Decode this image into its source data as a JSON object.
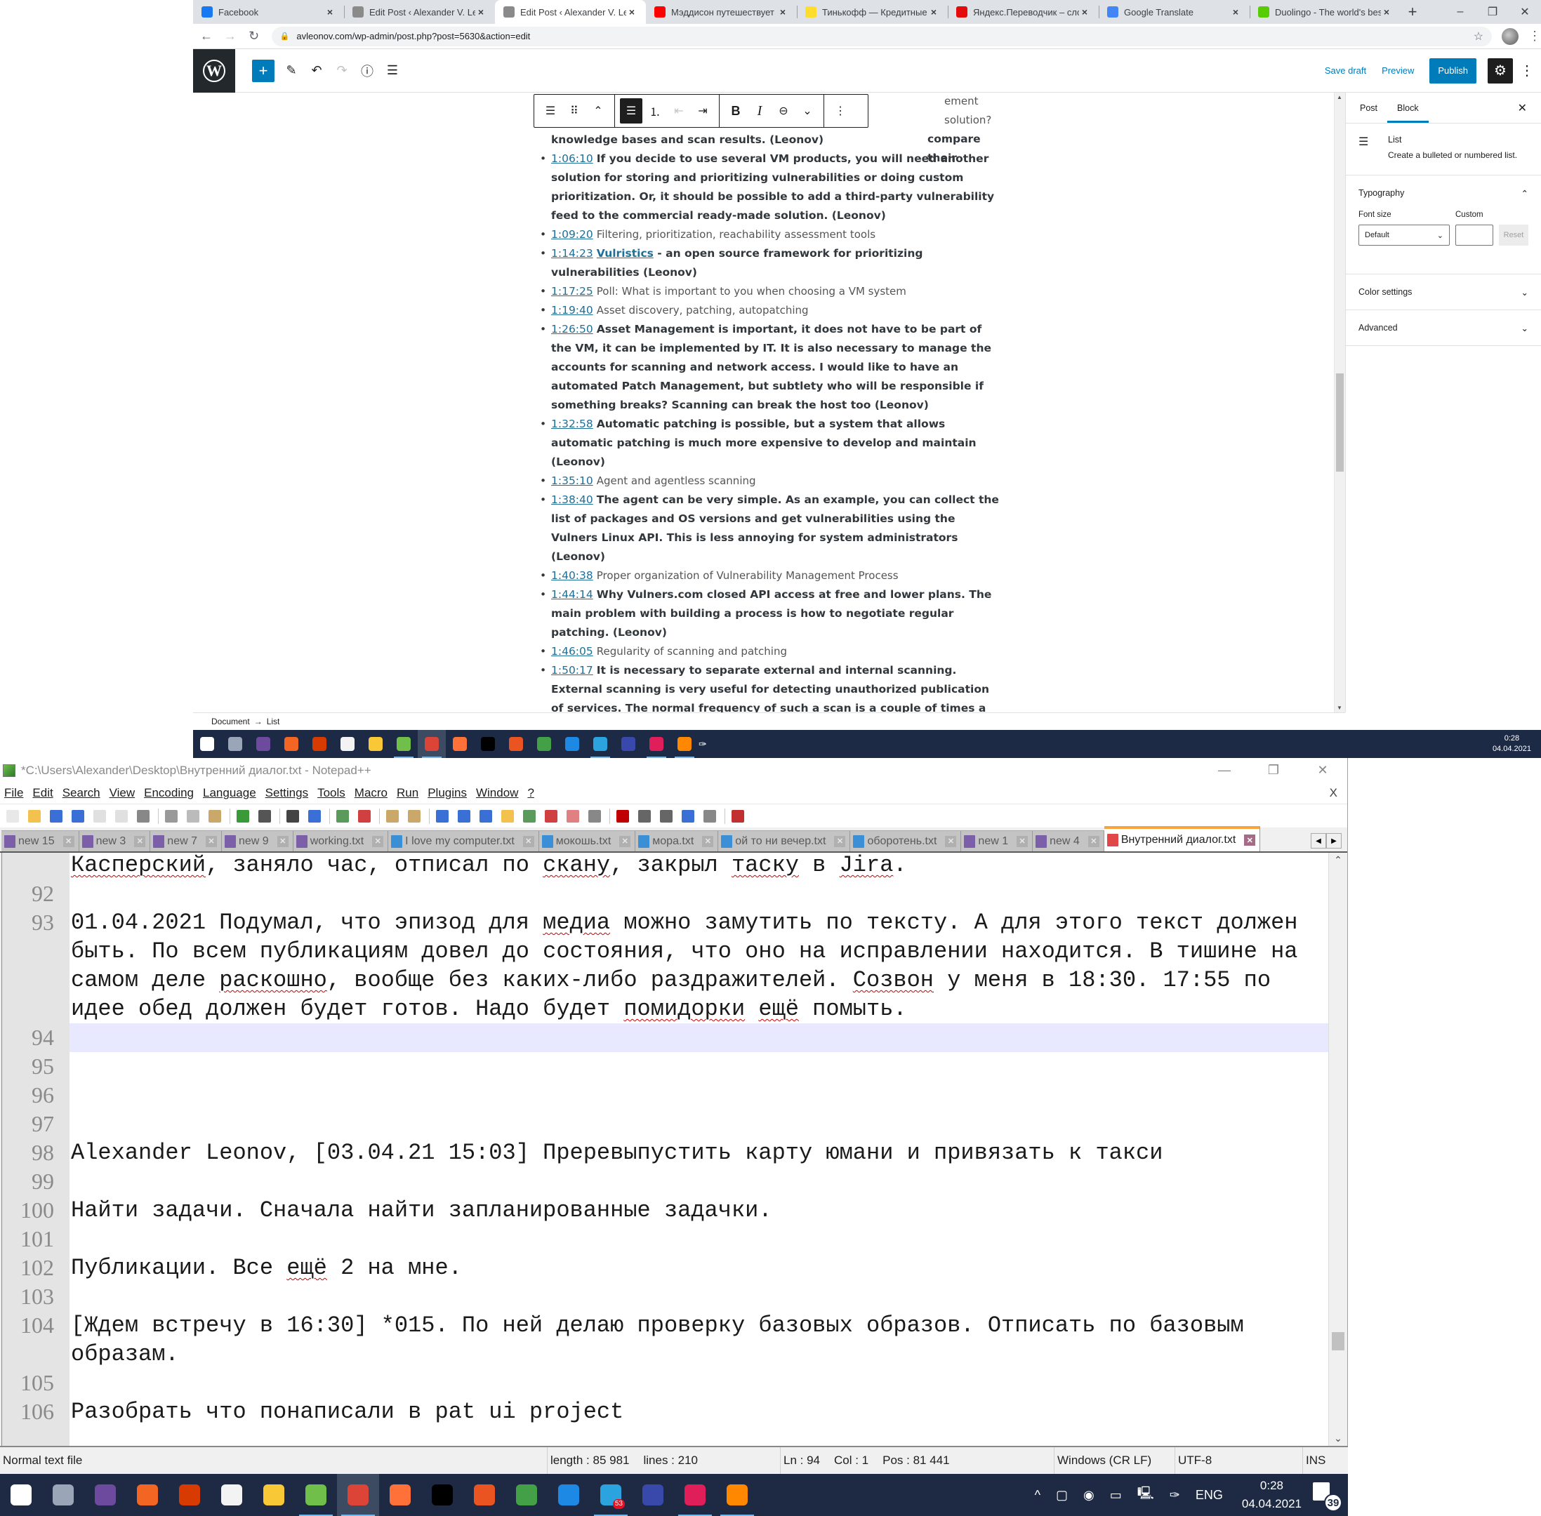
{
  "browser": {
    "tabs": [
      {
        "title": "Facebook",
        "favicon": "facebook-icon",
        "color": "#1877f2",
        "active": false
      },
      {
        "title": "Edit Post ‹ Alexander V. Leo",
        "favicon": "avl-icon",
        "color": "#8a8a8a",
        "active": false
      },
      {
        "title": "Edit Post ‹ Alexander V. Leo",
        "favicon": "avl-icon",
        "color": "#8a8a8a",
        "active": true
      },
      {
        "title": "Мэддисон путешествует по",
        "favicon": "youtube-icon",
        "color": "#ff0000",
        "active": false
      },
      {
        "title": "Тинькофф — Кредитные и",
        "favicon": "tinkoff-icon",
        "color": "#ffdd2d",
        "active": false
      },
      {
        "title": "Яндекс.Переводчик – слов",
        "favicon": "yandex-translate-icon",
        "color": "#e30b0b",
        "active": false
      },
      {
        "title": "Google Translate",
        "favicon": "google-translate-icon",
        "color": "#4285f4",
        "active": false
      },
      {
        "title": "Duolingo - The world's best",
        "favicon": "duolingo-icon",
        "color": "#58cc02",
        "active": false
      }
    ],
    "url": "avleonov.com/wp-admin/post.php?post=5630&action=edit"
  },
  "wp": {
    "header": {
      "save_draft": "Save draft",
      "preview": "Preview",
      "publish": "Publish",
      "accent": "#007cba"
    },
    "partial_first_line": "ement solution?",
    "partial_second_line": "compare their",
    "list_items": [
      {
        "ts": "",
        "bold": true,
        "text": "knowledge bases and scan results. (Leonov)",
        "continuation": true
      },
      {
        "ts": "1:06:10",
        "bold": true,
        "text": "If you decide to use several VM products, you will need another solution for storing and prioritizing vulnerabilities or doing custom prioritization. Or, it should be possible to add a third-party vulnerability feed to the commercial ready-made solution. (Leonov)"
      },
      {
        "ts": "1:09:20",
        "bold": false,
        "text": "Filtering, prioritization, reachability assessment tools"
      },
      {
        "ts": "1:14:23",
        "bold": true,
        "link": "Vulristics",
        "text": " - an open source framework for prioritizing vulnerabilities (Leonov)"
      },
      {
        "ts": "1:17:25",
        "bold": false,
        "text": "Poll: What is important to you when choosing a VM system"
      },
      {
        "ts": "1:19:40",
        "bold": false,
        "text": "Asset discovery, patching, autopatching"
      },
      {
        "ts": "1:26:50",
        "bold": true,
        "text": "Asset Management is important, it does not have to be part of the VM, it can be implemented by IT. It is also necessary to manage the accounts for scanning and network access. I would like to have an automated Patch Management, but subtlety who will be responsible if something breaks? Scanning can break the host too (Leonov)"
      },
      {
        "ts": "1:32:58",
        "bold": true,
        "text": "Automatic patching is possible, but a system that allows automatic patching is much more expensive to develop and maintain (Leonov)"
      },
      {
        "ts": "1:35:10",
        "bold": false,
        "text": "Agent and agentless scanning"
      },
      {
        "ts": "1:38:40",
        "bold": true,
        "text": "The agent can be very simple. As an example, you can collect the list of packages and OS versions and get vulnerabilities using the Vulners Linux API. This is less annoying for system administrators (Leonov)"
      },
      {
        "ts": "1:40:38",
        "bold": false,
        "text": "Proper organization of Vulnerability Management Process"
      },
      {
        "ts": "1:44:14",
        "bold": true,
        "text": "Why Vulners.com closed API access at free and lower plans. The main problem with building a process is how to negotiate regular patching. (Leonov)"
      },
      {
        "ts": "1:46:05",
        "bold": false,
        "text": "Regularity of scanning and patching"
      },
      {
        "ts": "1:50:17",
        "bold": true,
        "text": "It is necessary to separate external and internal scanning. External scanning is very useful for detecting unauthorized publication of services. The normal frequency of such a scan is a couple of times a week. Active internal scanning depends on agreements with the system owners. If you can say \"we scan everything - if you are not ready, your problems\" is good, but it does not work everywhere and not always. (Leonov)"
      }
    ],
    "sidebar": {
      "tabs": [
        "Post",
        "Block"
      ],
      "active_tab": "Block",
      "block_name": "List",
      "block_desc": "Create a bulleted or numbered list.",
      "typography": "Typography",
      "font_size_label": "Font size",
      "custom_label": "Custom",
      "font_size_value": "Default",
      "reset": "Reset",
      "color_settings": "Color settings",
      "advanced": "Advanced"
    },
    "breadcrumb": [
      "Document",
      "List"
    ]
  },
  "taskbar_top": {
    "time": "0:28",
    "date": "04.04.2021"
  },
  "npp": {
    "title": "*C:\\Users\\Alexander\\Desktop\\Внутренний диалог.txt - Notepad++",
    "menu": [
      "File",
      "Edit",
      "Search",
      "View",
      "Encoding",
      "Language",
      "Settings",
      "Tools",
      "Macro",
      "Run",
      "Plugins",
      "Window",
      "?"
    ],
    "close_doc": "X",
    "tabs": [
      {
        "label": "new 15",
        "color": "#7b5fa8"
      },
      {
        "label": "new 3",
        "color": "#7b5fa8"
      },
      {
        "label": "new 7",
        "color": "#7b5fa8"
      },
      {
        "label": "new 9",
        "color": "#7b5fa8"
      },
      {
        "label": "working.txt",
        "color": "#7b5fa8"
      },
      {
        "label": "I love my computer.txt",
        "color": "#3a8fd6"
      },
      {
        "label": "мокошь.txt",
        "color": "#3a8fd6"
      },
      {
        "label": "мора.txt",
        "color": "#3a8fd6"
      },
      {
        "label": "ой то ни вечер.txt",
        "color": "#3a8fd6"
      },
      {
        "label": "оборотень.txt",
        "color": "#3a8fd6"
      },
      {
        "label": "new 1",
        "color": "#7b5fa8"
      },
      {
        "label": "new 4",
        "color": "#7b5fa8"
      },
      {
        "label": "Внутренний диалог.txt",
        "color": "#e04848",
        "active": true
      }
    ],
    "lines": [
      {
        "n": "",
        "text": "Касперский, заняло час, отписал по скану, закрыл таску в Jira."
      },
      {
        "n": "92",
        "text": ""
      },
      {
        "n": "93",
        "text": "01.04.2021 Подумал, что эпизод для медиа можно замутить по тексту. А для этого текст должен быть. По всем публикациям довел до состояния, что оно на исправлении находится. В тишине на самом деле раскошно, вообще без каких-либо раздражителей. Созвон у меня в 18:30. 17:55 по идее обед должен будет готов. Надо будет помидорки ещё помыть."
      },
      {
        "n": "94",
        "text": "",
        "current": true
      },
      {
        "n": "95",
        "text": ""
      },
      {
        "n": "96",
        "text": ""
      },
      {
        "n": "97",
        "text": ""
      },
      {
        "n": "98",
        "text": "Alexander Leonov, [03.04.21 15:03] Преревыпустить карту юмани и привязать к такси"
      },
      {
        "n": "99",
        "text": ""
      },
      {
        "n": "100",
        "text": "Найти задачи. Сначала найти запланированные задачки."
      },
      {
        "n": "101",
        "text": ""
      },
      {
        "n": "102",
        "text": "Публикации. Все ещё 2 на мне."
      },
      {
        "n": "103",
        "text": ""
      },
      {
        "n": "104",
        "text": "[Ждем встречу в 16:30] *015. По ней делаю проверку базовых образов. Отписать по базовым образам."
      },
      {
        "n": "105",
        "text": ""
      },
      {
        "n": "106",
        "text": "Разобрать что понаписали в pat ui project"
      }
    ],
    "misspelled": [
      "Касперский",
      "скану",
      "таску",
      "Jira",
      "медиа",
      "раскошно",
      "Созвон",
      "помидорки",
      "ещё"
    ],
    "status": {
      "type": "Normal text file",
      "length": "length : 85 981",
      "lines": "lines : 210",
      "ln": "Ln : 94",
      "col": "Col : 1",
      "pos": "Pos : 81 441",
      "eol": "Windows (CR LF)",
      "encoding": "UTF-8",
      "mode": "INS"
    }
  },
  "taskbar": {
    "apps": [
      {
        "name": "github-desktop-icon",
        "color": "#6e4a9e"
      },
      {
        "name": "megaphone-icon",
        "color": "#f26522"
      },
      {
        "name": "snipping-tool-icon",
        "color": "#d83b01"
      },
      {
        "name": "microsoft-store-icon",
        "color": "#f3f3f3"
      },
      {
        "name": "file-explorer-icon",
        "color": "#f8c837"
      },
      {
        "name": "notepad-plus-plus-icon",
        "color": "#6fbf4a",
        "open": true
      },
      {
        "name": "chrome-icon",
        "color": "#db4437",
        "open": true,
        "active": true
      },
      {
        "name": "firefox-icon",
        "color": "#ff7139"
      },
      {
        "name": "terminal-icon",
        "color": "#000000"
      },
      {
        "name": "ubuntu-icon",
        "color": "#e95420"
      },
      {
        "name": "vm-icon",
        "color": "#43a047"
      },
      {
        "name": "vscode-icon",
        "color": "#1e88e5"
      },
      {
        "name": "telegram-icon",
        "color": "#2aa3df",
        "badge": "53",
        "open": true
      },
      {
        "name": "remote-desktop-icon",
        "color": "#3949ab"
      },
      {
        "name": "slack-icon",
        "color": "#e01e5a",
        "open": true
      },
      {
        "name": "vlc-icon",
        "color": "#ff8800",
        "open": true
      }
    ],
    "tray": {
      "lang": "ENG",
      "time": "0:28",
      "date": "04.04.2021",
      "notifications": "39"
    }
  }
}
